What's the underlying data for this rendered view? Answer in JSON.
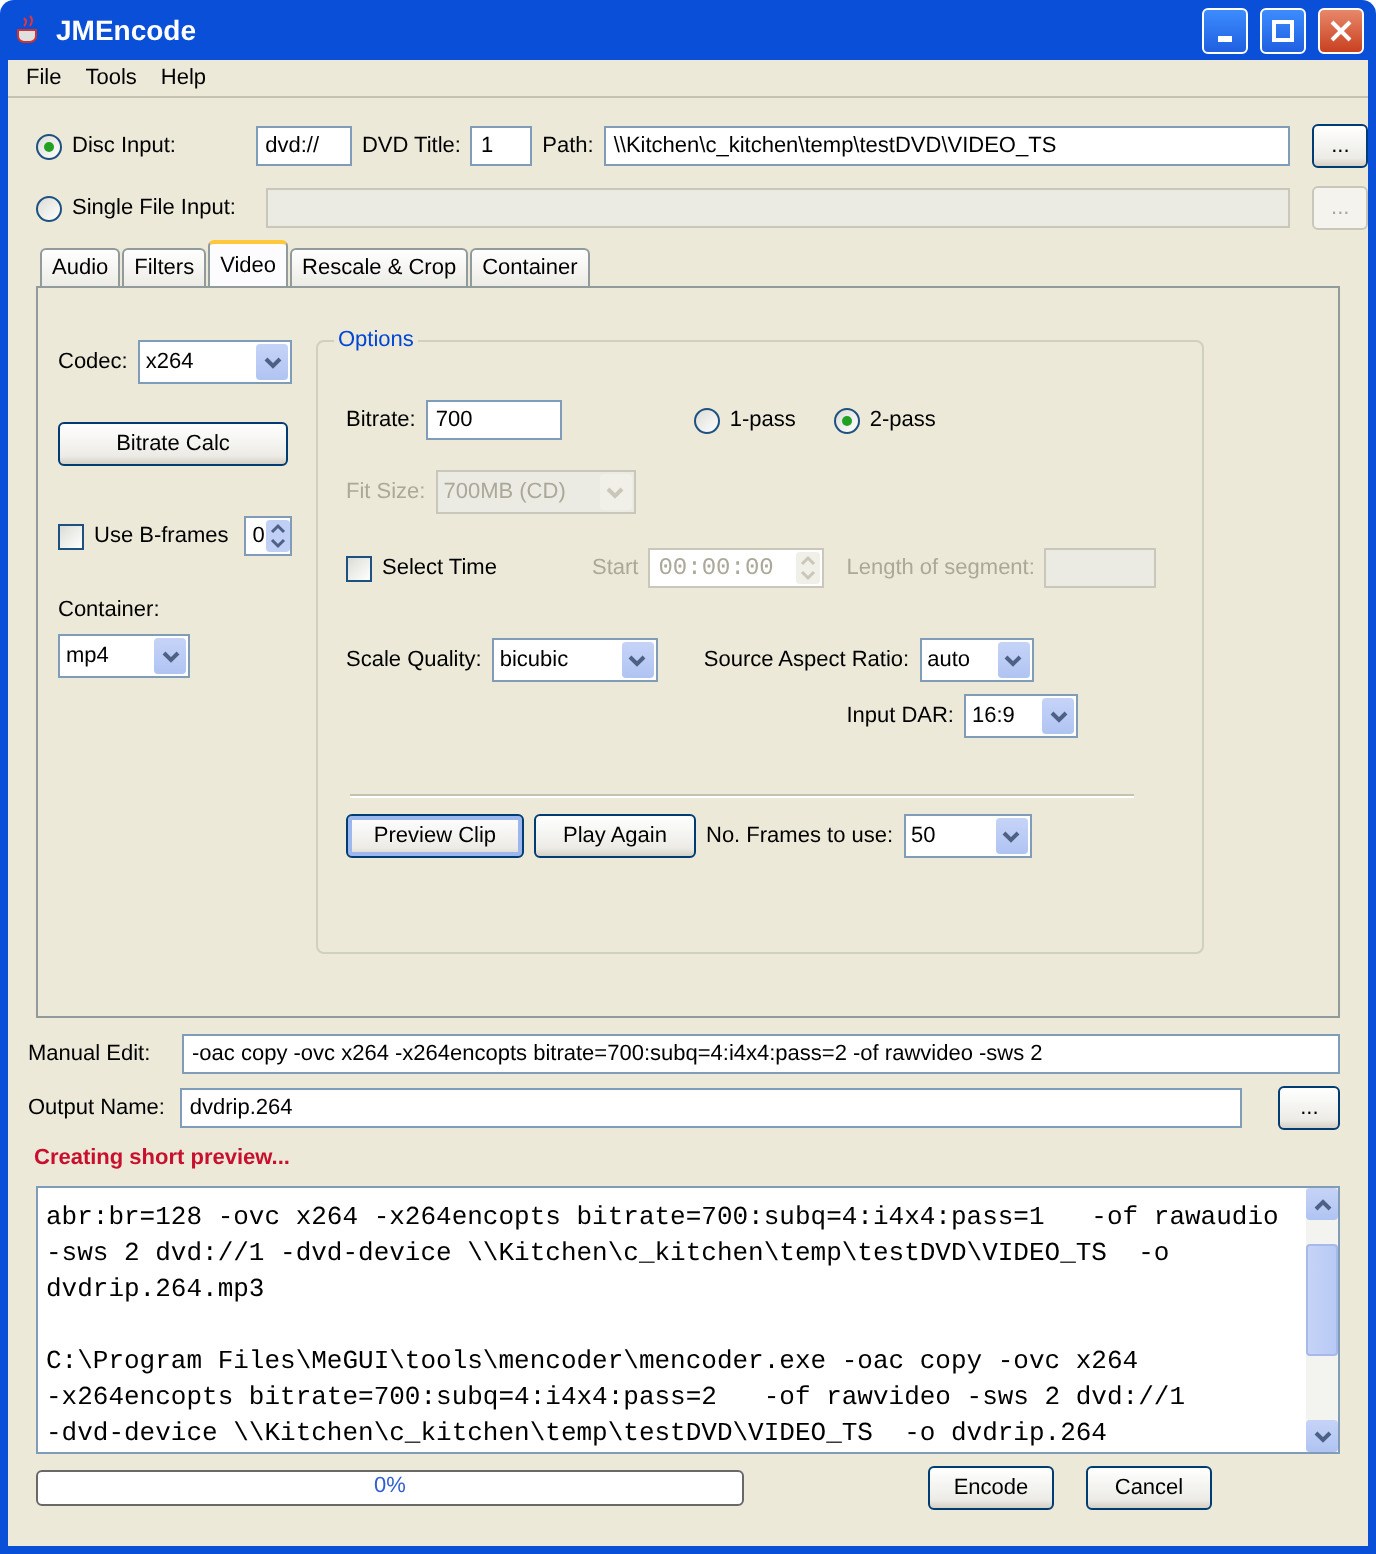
{
  "window": {
    "title": "JMEncode"
  },
  "menu": [
    "File",
    "Tools",
    "Help"
  ],
  "disc_input": {
    "label": "Disc Input:",
    "selected": true,
    "value": "dvd://",
    "title_label": "DVD Title:",
    "title_value": "1",
    "path_label": "Path:",
    "path_value": "\\\\Kitchen\\c_kitchen\\temp\\testDVD\\VIDEO_TS",
    "browse": "..."
  },
  "single_file_input": {
    "label": "Single File Input:",
    "selected": false,
    "browse": "...",
    "disabled": true
  },
  "tabs": [
    {
      "label": "Audio",
      "selected": false
    },
    {
      "label": "Filters",
      "selected": false
    },
    {
      "label": "Video",
      "selected": true
    },
    {
      "label": "Rescale & Crop",
      "selected": false
    },
    {
      "label": "Container",
      "selected": false
    }
  ],
  "video": {
    "codec": {
      "label": "Codec:",
      "value": "x264"
    },
    "bitrate_calc": "Bitrate Calc",
    "use_bframes": {
      "label": "Use B-frames",
      "checked": false,
      "value": "0"
    },
    "container": {
      "label": "Container:",
      "value": "mp4"
    }
  },
  "options": {
    "title": "Options",
    "bitrate": {
      "label": "Bitrate:",
      "value": "700"
    },
    "passes": [
      {
        "label": "1-pass",
        "selected": false
      },
      {
        "label": "2-pass",
        "selected": true
      }
    ],
    "fit_size": {
      "label": "Fit Size:",
      "value": "700MB (CD)",
      "disabled": true
    },
    "select_time": {
      "label": "Select Time",
      "checked": false
    },
    "start": {
      "label": "Start",
      "value": "00:00:00",
      "disabled": true
    },
    "length": {
      "label": "Length of segment:",
      "disabled": true
    },
    "scale_quality": {
      "label": "Scale Quality:",
      "value": "bicubic"
    },
    "source_aspect_ratio": {
      "label": "Source Aspect Ratio:",
      "value": "auto"
    },
    "input_dar": {
      "label": "Input DAR:",
      "value": "16:9"
    },
    "buttons": [
      {
        "label": "Preview Clip",
        "focused": true
      },
      {
        "label": "Play Again",
        "focused": false
      }
    ],
    "frames": {
      "label": "No. Frames to use:",
      "value": "50"
    }
  },
  "manual_edit": {
    "label": "Manual Edit:",
    "value": "-oac copy -ovc x264 -x264encopts bitrate=700:subq=4:i4x4:pass=2   -of rawvideo -sws 2"
  },
  "output_name": {
    "label": "Output Name:",
    "value": "dvdrip.264",
    "browse": "..."
  },
  "status": "Creating short preview...",
  "log": [
    [
      "abr:br=128 -ovc x264 -x264encopts bitrate=700:subq=4:i4x4:pass=1   -of rawaudio",
      "-sws 2 dvd://1 -dvd-device \\\\Kitchen\\c_kitchen\\temp\\testDVD\\VIDEO_TS  -o",
      "dvdrip.264.mp3"
    ],
    [
      "C:\\Program Files\\MeGUI\\tools\\mencoder\\mencoder.exe -oac copy -ovc x264",
      "-x264encopts bitrate=700:subq=4:i4x4:pass=2   -of rawvideo -sws 2 dvd://1",
      "-dvd-device \\\\Kitchen\\c_kitchen\\temp\\testDVD\\VIDEO_TS  -o dvdrip.264"
    ]
  ],
  "progress": {
    "level": 0,
    "text": "0%"
  },
  "buttons": [
    "Encode",
    "Cancel"
  ]
}
